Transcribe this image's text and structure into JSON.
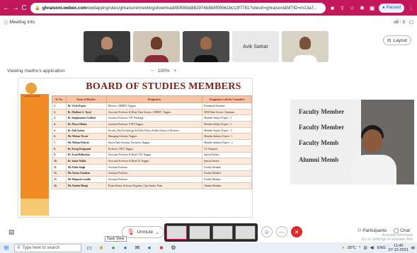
{
  "browser": {
    "url_host": "ghraisoni.webex.com",
    "url_path": "/webappng/sites/ghraisoni/meeting/download/80f00bd882974b8b8f99561bc13f7781?siteurl=ghraisoni&MTID=m13a7...",
    "paused_label": "Paused"
  },
  "meeting": {
    "info_label": "Meeting Info",
    "timer": "s8 : 3",
    "layout_label": "Layout",
    "tile_name_avik": "Avik Sarkar",
    "viewing_label": "Viewing madhu's application",
    "zoom_minus": "−",
    "zoom_level": "100%",
    "zoom_plus": "+"
  },
  "slide": {
    "title": "BOARD OF STUDIES MEMBERS",
    "logo_text": "RAISONI GROUP",
    "columns": [
      "Sr. No.",
      "Name of Member",
      "Designation",
      "Designation with the Committee"
    ],
    "rows": [
      [
        "1.",
        "Dr. Vivek Kapur",
        "Director, GHRIET, Nagpur.",
        "Permanent Nominee"
      ],
      [
        "2.",
        "Dr. Madhuri A. Tayal",
        "Associate Professor & Head, Data Science, GHRIET, Nagpur.",
        "HOD Data Science Chairman"
      ],
      [
        "3.",
        "Dr. Sanghamitra Godbole",
        "Assistant Professor, NIT Warangal.",
        "Member Subject Expert - 1"
      ],
      [
        "4.",
        "Dr. Meera Dhabu",
        "Assistant Professor, VNIT Nagpur.",
        "Member Subject Expert - 2"
      ],
      [
        "5.",
        "Dr. Avik Sarkar",
        "Faculty, Data Technology & Public Policy, Indian School of Business.",
        "Member Subject Expert - 3"
      ],
      [
        "6.",
        "Mr. Mohan Tiwari",
        "Managing Solution, Nagpur.",
        "Member Industry Expert - 1"
      ],
      [
        "7.",
        "Mr. Mohan Paliwal",
        "Senior Data Scientist, Persistent, Nagpur.",
        "Member Industry Expert - 2"
      ],
      [
        "8.",
        "Dr. Parag Deshpande",
        "Professor VNIT, Nagpur.",
        "VC Nominee"
      ],
      [
        "9.",
        "Dr. Swati Ridhorkar",
        "Associate Professor & Head CSE, Nagpur.",
        "Special Invitee"
      ],
      [
        "10.",
        "Dr. Smita Nirkhi",
        "Associate Professor & Head AI, Nagpur.",
        "Special Invitee"
      ],
      [
        "11.",
        "Mr. Rohit Singh",
        "Assistant Professor",
        "Faculty Member"
      ],
      [
        "12.",
        "Ms. Reena Chauhan",
        "Assistant Professor",
        "Faculty Member"
      ],
      [
        "13.",
        "Mr. Bhupesh Londhe",
        "Assistant Professor",
        "Faculty Member"
      ],
      [
        "14.",
        "Ms. Roshni Mangi",
        "Project/Senior Software Engineer, Cap Gemini, Pune.",
        "Alumni Member"
      ]
    ]
  },
  "video": {
    "board_lines": [
      "Faculty Member",
      "Faculty Member",
      "Faculty Memb",
      "Alumni Memb"
    ]
  },
  "controls": {
    "unmute_label": "Unmute",
    "participants_label": "Participants",
    "chat_label": "Chat",
    "task_view_tip": "Task View"
  },
  "taskbar": {
    "search_placeholder": "Type here to search",
    "temperature": "28°C",
    "lang": "ENG",
    "time": "11:40",
    "date": "07-12-2021"
  },
  "watermark": {
    "line1": "Activate Windows",
    "line2": "Go to Settings to activate Win"
  }
}
